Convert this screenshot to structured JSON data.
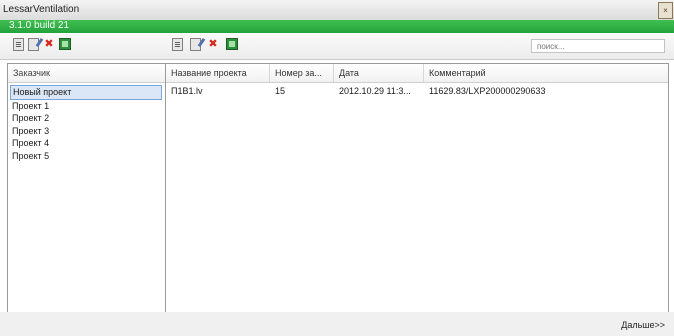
{
  "window": {
    "title": "LessarVentilation",
    "close_glyph": "×"
  },
  "version": "3.1.0 build 21",
  "toolbar_left": [
    {
      "name": "new-customer-icon"
    },
    {
      "name": "edit-customer-icon"
    },
    {
      "name": "delete-customer-icon"
    },
    {
      "name": "export-customer-icon"
    }
  ],
  "toolbar_right": [
    {
      "name": "new-project-icon"
    },
    {
      "name": "edit-project-icon"
    },
    {
      "name": "delete-project-icon"
    },
    {
      "name": "export-project-icon"
    }
  ],
  "search": {
    "placeholder": "поиск..."
  },
  "customers": {
    "header": "Заказчик",
    "items": [
      "Новый проект",
      "Проект 1",
      "Проект 2",
      "Проект 3",
      "Проект 4",
      "Проект 5"
    ]
  },
  "projects": {
    "columns": [
      "Название проекта",
      "Номер за...",
      "Дата",
      "Комментарий"
    ],
    "rows": [
      [
        "П1В1.lv",
        "15",
        "2012.10.29 11:3...",
        "11629.83/LXP200000290633"
      ]
    ]
  },
  "footer": {
    "next_label": "Дальше>>"
  },
  "colors": {
    "accent_green": "#22a23a",
    "selection": "#dbe7f6",
    "delete_red": "#d42a1e"
  }
}
